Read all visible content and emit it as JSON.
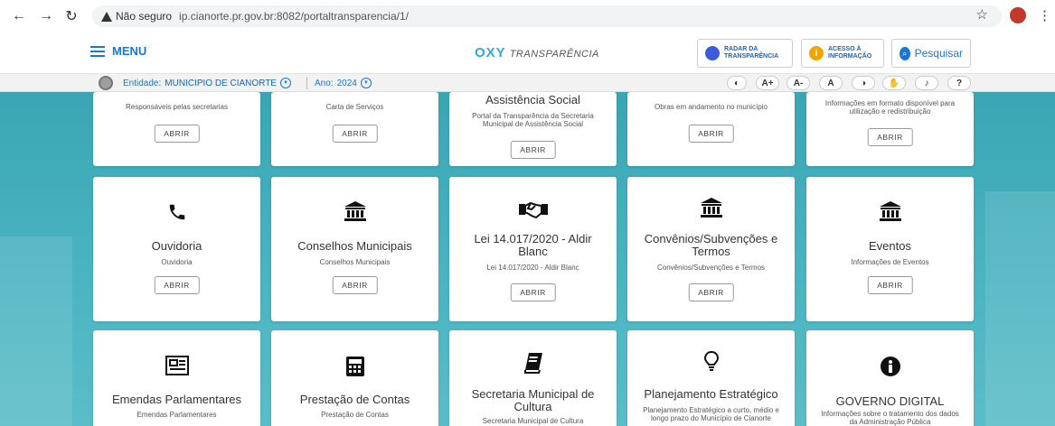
{
  "browser": {
    "security_label": "Não seguro",
    "url": "ip.cianorte.pr.gov.br:8082/portaltransparencia/1/"
  },
  "header": {
    "menu_label": "MENU",
    "logo_oxy": "OXY",
    "logo_text": "TRANSPARÊNCIA",
    "radar_line1": "RADAR DA",
    "radar_line2": "TRANSPARÊNCIA",
    "acesso_line1": "ACESSO À",
    "acesso_line2": "INFORMAÇÃO",
    "pesquisar_label": "Pesquisar"
  },
  "entity_bar": {
    "entidade_label": "Entidade:",
    "entidade_value": "MUNICIPIO DE CIANORTE",
    "ano_label": "Ano:",
    "ano_value": "2024",
    "accessibility": [
      "",
      "A+",
      "A-",
      "A",
      "",
      "",
      "",
      "?"
    ]
  },
  "cards": [
    {
      "title": "",
      "subtitle": "Responsáveis pelas secretarias",
      "button": "ABRIR",
      "icon": "none"
    },
    {
      "title": "",
      "subtitle": "Carta de Serviços",
      "button": "ABRIR",
      "icon": "none"
    },
    {
      "title": "Assistência Social",
      "subtitle": "Portal da Transparência da Secretaria Municipal de Assistência Social",
      "button": "ABRIR",
      "icon": "none"
    },
    {
      "title": "",
      "subtitle": "Obras em andamento no município",
      "button": "ABRIR",
      "icon": "none"
    },
    {
      "title": "",
      "subtitle": "Informações em formato disponível para utilização e redistribuição",
      "button": "ABRIR",
      "icon": "none"
    },
    {
      "title": "Ouvidoria",
      "subtitle": "Ouvidoria",
      "button": "ABRIR",
      "icon": "phone-icon"
    },
    {
      "title": "Conselhos Municipais",
      "subtitle": "Conselhos Municipais",
      "button": "ABRIR",
      "icon": "institution-icon"
    },
    {
      "title": "Lei 14.017/2020 - Aldir Blanc",
      "subtitle": "Lei 14.017/2020 - Aldir Blanc",
      "button": "ABRIR",
      "icon": "handshake-icon"
    },
    {
      "title": "Convênios/Subvenções e Termos",
      "subtitle": "Convênios/Subvenções e Termos",
      "button": "ABRIR",
      "icon": "institution-icon"
    },
    {
      "title": "Eventos",
      "subtitle": "Informações de Eventos",
      "button": "ABRIR",
      "icon": "institution-icon"
    },
    {
      "title": "Emendas Parlamentares",
      "subtitle": "Emendas Parlamentares",
      "button": "",
      "icon": "newspaper-icon"
    },
    {
      "title": "Prestação de Contas",
      "subtitle": "Prestação de Contas",
      "button": "",
      "icon": "calculator-icon"
    },
    {
      "title": "Secretaria Municipal de Cultura",
      "subtitle": "Secretaria Municipal de Cultura",
      "button": "",
      "icon": "book-icon"
    },
    {
      "title": "Planejamento Estratégico",
      "subtitle": "Planejamento Estratégico a curto, médio e longo prazo do Município de Cianorte",
      "button": "",
      "icon": "lightbulb-icon"
    },
    {
      "title": "GOVERNO DIGITAL",
      "subtitle": "Informações sobre o tratamento dos dados da Administração Pública",
      "button": "",
      "icon": "info-icon"
    }
  ],
  "colors": {
    "accent": "#1976d2",
    "background": "#4cb5c2"
  }
}
